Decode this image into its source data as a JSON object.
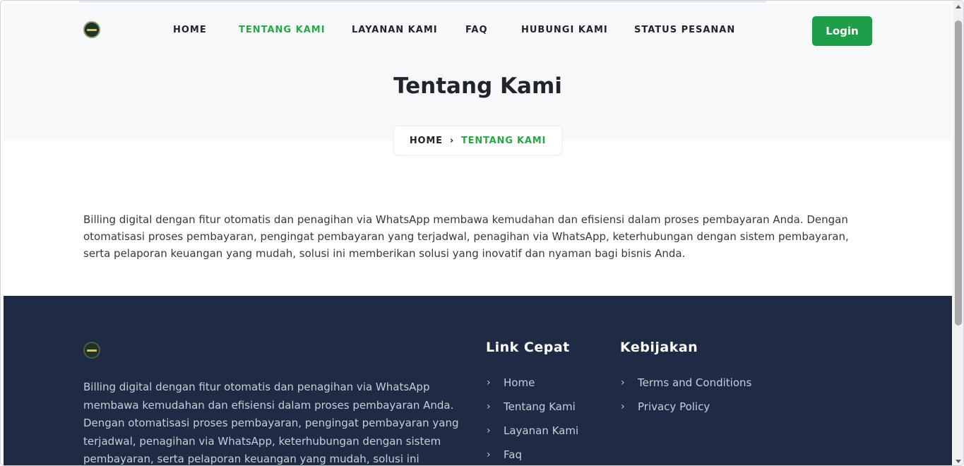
{
  "nav": {
    "items": [
      {
        "label": "HOME",
        "active": false
      },
      {
        "label": "TENTANG KAMI",
        "active": true
      },
      {
        "label": "LAYANAN KAMI",
        "active": false
      },
      {
        "label": "FAQ",
        "active": false
      },
      {
        "label": "HUBUNGI KAMI",
        "active": false
      },
      {
        "label": "STATUS PESANAN",
        "active": false
      }
    ],
    "login_label": "Login"
  },
  "hero": {
    "title": "Tentang Kami",
    "breadcrumb_home": "HOME",
    "breadcrumb_current": "TENTANG KAMI"
  },
  "intro": {
    "text": "Billing digital dengan fitur otomatis dan penagihan via WhatsApp membawa kemudahan dan efisiensi dalam proses pembayaran Anda. Dengan otomatisasi proses pembayaran, pengingat pembayaran yang terjadwal, penagihan via WhatsApp, keterhubungan dengan sistem pembayaran, serta pelaporan keuangan yang mudah, solusi ini memberikan solusi yang inovatif dan nyaman bagi bisnis Anda."
  },
  "footer": {
    "about": "Billing digital dengan fitur otomatis dan penagihan via WhatsApp membawa kemudahan dan efisiensi dalam proses pembayaran Anda. Dengan otomatisasi proses pembayaran, pengingat pembayaran yang terjadwal, penagihan via WhatsApp, keterhubungan dengan sistem pembayaran, serta pelaporan keuangan yang mudah, solusi ini memberikan",
    "quick_links": {
      "heading": "Link Cepat",
      "items": [
        "Home",
        "Tentang Kami",
        "Layanan Kami",
        "Faq"
      ]
    },
    "policy": {
      "heading": "Kebijakan",
      "items": [
        "Terms and Conditions",
        "Privacy Policy"
      ]
    }
  },
  "colors": {
    "accent": "#28a745",
    "button": "#1e9e48",
    "footer_bg": "#1f2a44",
    "hero_bg": "#f7f8fa"
  },
  "icons": {
    "breadcrumb_separator": "chevron-right-icon",
    "footer_link_bullet": "chevron-right-icon"
  }
}
